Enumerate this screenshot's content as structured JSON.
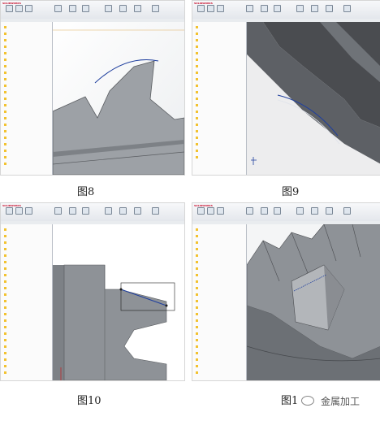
{
  "app": {
    "name": "SOLIDWORKS"
  },
  "panels": [
    {
      "id": "fig8",
      "caption": "图8"
    },
    {
      "id": "fig9",
      "caption": "图9"
    },
    {
      "id": "fig10",
      "caption": "图10"
    },
    {
      "id": "fig11",
      "caption": "图1"
    }
  ],
  "watermark": {
    "text": "金属加工"
  },
  "colors": {
    "ribbon": "#e4e7ec",
    "part_gray": "#8e9297",
    "dark_gray": "#4a4c50",
    "sketch_blue": "#1f3f9e"
  }
}
